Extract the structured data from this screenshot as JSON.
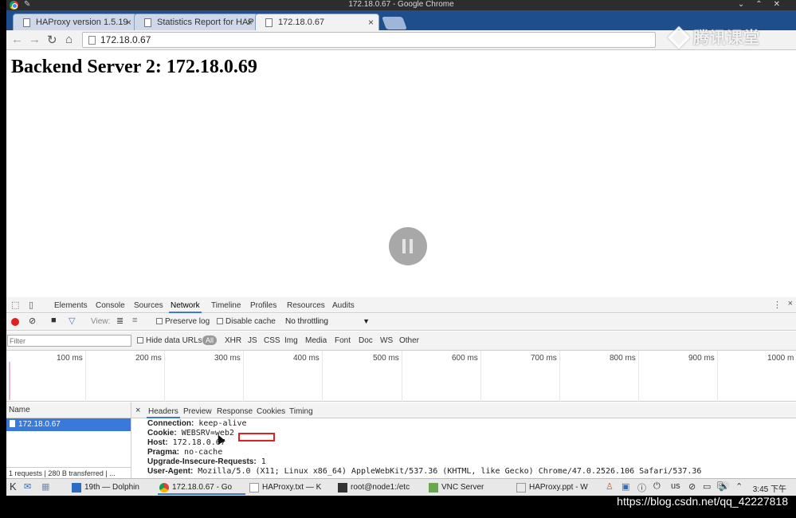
{
  "window": {
    "title": "172.18.0.67 - Google Chrome"
  },
  "tabs": [
    {
      "label": "HAProxy version 1.5.19"
    },
    {
      "label": "Statistics Report for HAP"
    },
    {
      "label": "172.18.0.67"
    }
  ],
  "address_bar": {
    "url": "172.18.0.67"
  },
  "watermark": {
    "text": "腾讯课堂"
  },
  "page": {
    "heading": "Backend Server 2: 172.18.0.69"
  },
  "devtools": {
    "tabs": [
      "Elements",
      "Console",
      "Sources",
      "Network",
      "Timeline",
      "Profiles",
      "Resources",
      "Audits"
    ],
    "active_tab": "Network",
    "controls": {
      "view_label": "View:",
      "preserve_log": "Preserve log",
      "disable_cache": "Disable cache",
      "throttling": "No throttling"
    },
    "filter": {
      "placeholder": "Filter",
      "hide_data_urls": "Hide data URLs",
      "all": "All",
      "types": [
        "XHR",
        "JS",
        "CSS",
        "Img",
        "Media",
        "Font",
        "Doc",
        "WS",
        "Other"
      ]
    },
    "timeline_ticks": [
      "100 ms",
      "200 ms",
      "300 ms",
      "400 ms",
      "500 ms",
      "600 ms",
      "700 ms",
      "800 ms",
      "900 ms",
      "1000 m"
    ],
    "requests": {
      "header": "Name",
      "rows": [
        "172.18.0.67"
      ],
      "summary": "1 requests | 280 B transferred | ..."
    },
    "detail": {
      "tabs": [
        "Headers",
        "Preview",
        "Response",
        "Cookies",
        "Timing"
      ],
      "headers": [
        {
          "name": "Connection:",
          "value": "keep-alive"
        },
        {
          "name": "Cookie:",
          "value": "WEBSRV=web2"
        },
        {
          "name": "Host:",
          "value": "172.18.0.67"
        },
        {
          "name": "Pragma:",
          "value": "no-cache"
        },
        {
          "name": "Upgrade-Insecure-Requests:",
          "value": "1"
        },
        {
          "name": "User-Agent:",
          "value": "Mozilla/5.0 (X11; Linux x86_64) AppleWebKit/537.36 (KHTML, like Gecko) Chrome/47.0.2526.106 Safari/537.36"
        }
      ]
    }
  },
  "taskbar": {
    "tasks": [
      "19th — Dolphin",
      "172.18.0.67 - Go",
      "HAProxy.txt — K",
      "root@node1:/etc",
      "VNC Server",
      "HAProxy.ppt - W"
    ],
    "tray_text": "us",
    "clock": "3:45 下午"
  },
  "footer_url": "https://blog.csdn.net/qq_42227818"
}
